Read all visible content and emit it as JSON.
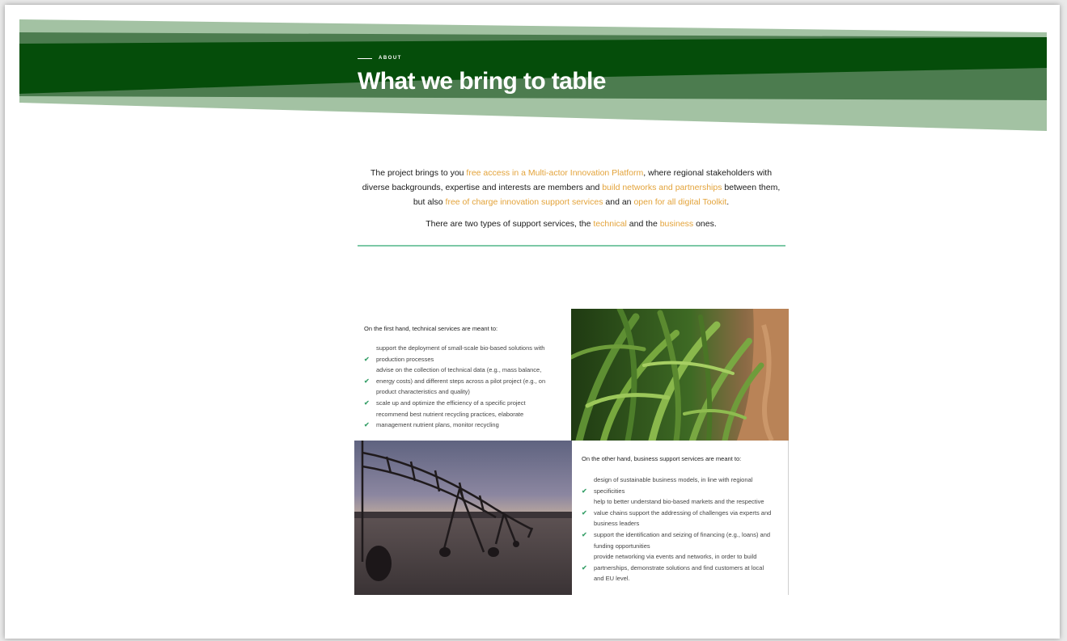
{
  "header": {
    "eyebrow": "ABOUT",
    "title": "What we bring to table"
  },
  "intro": {
    "p1_a": "The project brings to you ",
    "p1_link1": "free access in a Multi-actor Innovation Platform",
    "p1_b": ", where regional stakeholders with diverse backgrounds, expertise and interests are members and ",
    "p1_link2": "build networks and partnerships",
    "p1_c": " between them, but also ",
    "p1_link3": "free of charge innovation support services",
    "p1_d": " and an ",
    "p1_link4": "open for all digital Toolkit",
    "p1_e": ".",
    "p2_a": "There are two types of support services, the ",
    "p2_link1": "technical",
    "p2_b": " and the ",
    "p2_link2": "business",
    "p2_c": " ones."
  },
  "technical": {
    "intro": "On the first hand, technical services are meant to:",
    "items": [
      {
        "check": false,
        "text": "support the deployment of small-scale bio-based solutions with"
      },
      {
        "check": true,
        "text": "production processes"
      },
      {
        "check": false,
        "text": "advise on the collection of technical data (e.g., mass balance,"
      },
      {
        "check": true,
        "text": "energy costs) and different steps across a pilot project (e.g., on"
      },
      {
        "check": false,
        "text": "product characteristics and quality)"
      },
      {
        "check": true,
        "text": "scale up and optimize the efficiency of a specific project"
      },
      {
        "check": false,
        "text": "recommend best nutrient recycling practices, elaborate"
      },
      {
        "check": true,
        "text": "management nutrient plans, monitor recycling"
      }
    ]
  },
  "business": {
    "intro": "On the other hand, business support services are meant to:",
    "items": [
      {
        "check": false,
        "text": "design of sustainable business models, in line with regional"
      },
      {
        "check": true,
        "text": "specificities"
      },
      {
        "check": false,
        "text": "help to better understand bio-based markets and the respective"
      },
      {
        "check": true,
        "text": "value chains support the addressing of challenges via experts and"
      },
      {
        "check": false,
        "text": "business leaders"
      },
      {
        "check": true,
        "text": "support the identification and seizing of financing (e.g., loans) and"
      },
      {
        "check": false,
        "text": "funding opportunities"
      },
      {
        "check": false,
        "text": "provide networking via events and networks, in order to build"
      },
      {
        "check": true,
        "text": "partnerships, demonstrate solutions and find customers at local"
      },
      {
        "check": false,
        "text": "and EU level."
      }
    ]
  },
  "icons": {
    "check": "checkmark-icon",
    "images": [
      "corn-field-image",
      "irrigation-pivot-image"
    ]
  },
  "colors": {
    "banner_dark": "#054d0a",
    "banner_mid": "#4c7c4f",
    "banner_light": "#a3c2a3",
    "accent": "#e3a33a",
    "divider": "#7cc8a6",
    "check": "#3aa16b"
  }
}
